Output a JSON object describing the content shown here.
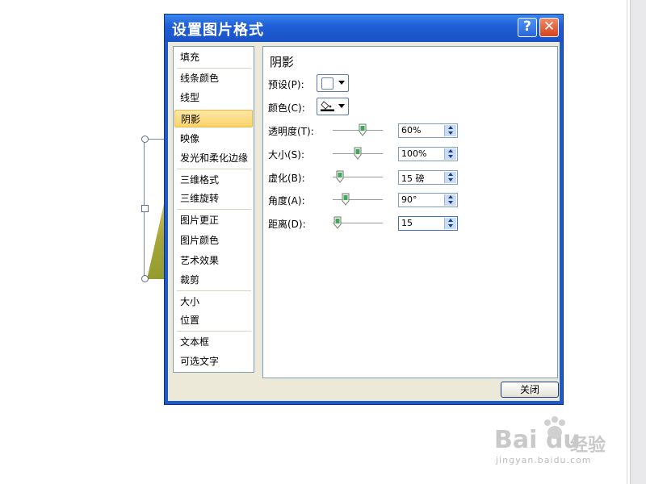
{
  "dialog": {
    "title": "设置图片格式",
    "help_glyph": "?",
    "close_glyph": "✕",
    "close_button_label": "关闭"
  },
  "nav": {
    "items": [
      {
        "label": "填充"
      },
      {
        "label": "线条颜色"
      },
      {
        "label": "线型"
      },
      {
        "label": "阴影",
        "selected": true
      },
      {
        "label": "映像"
      },
      {
        "label": "发光和柔化边缘"
      },
      {
        "label": "三维格式"
      },
      {
        "label": "三维旋转"
      },
      {
        "label": "图片更正"
      },
      {
        "label": "图片颜色"
      },
      {
        "label": "艺术效果"
      },
      {
        "label": "裁剪"
      },
      {
        "label": "大小"
      },
      {
        "label": "位置"
      },
      {
        "label": "文本框"
      },
      {
        "label": "可选文字"
      }
    ]
  },
  "shadow": {
    "section_title": "阴影",
    "preset_label": "预设(P):",
    "color_label": "颜色(C):",
    "params": [
      {
        "label": "透明度(T):",
        "value": "60%",
        "slider": 0.6
      },
      {
        "label": "大小(S):",
        "value": "100%",
        "slider": 0.5
      },
      {
        "label": "虚化(B):",
        "value": "15 磅",
        "slider": 0.15
      },
      {
        "label": "角度(A):",
        "value": "90°",
        "slider": 0.25
      },
      {
        "label": "距离(D):",
        "value": "15",
        "slider": 0.1
      }
    ]
  },
  "colors": {
    "selection_fill": "#fbd36a",
    "slider_thumb": "#3fa85a",
    "title_bar": "#1f5fd7"
  },
  "watermark": {
    "logo": "Bai du",
    "brand_cn": "经验",
    "url": "jingyan.baidu.com"
  }
}
